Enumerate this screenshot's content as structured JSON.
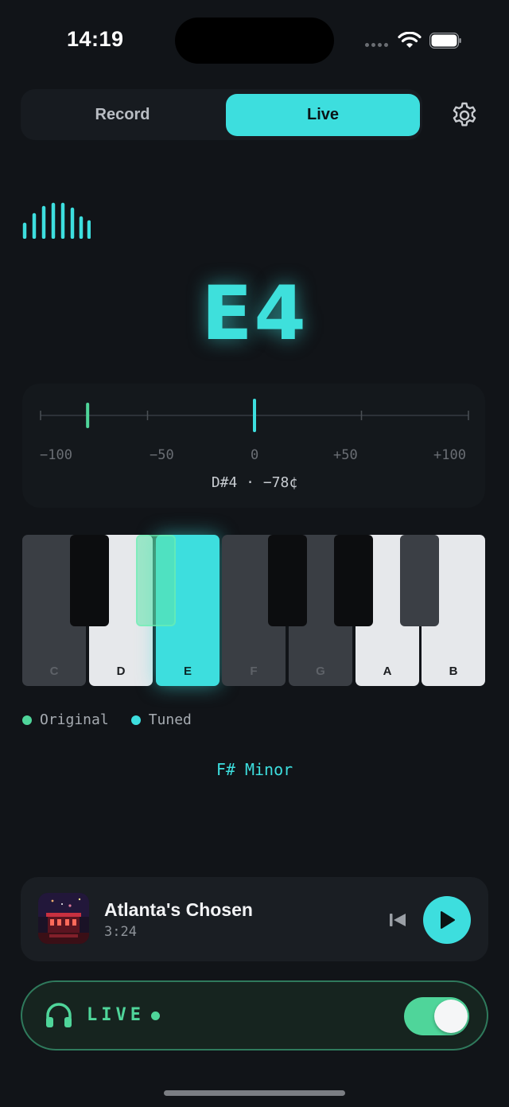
{
  "status_bar": {
    "time": "14:19"
  },
  "mode_tabs": {
    "record": "Record",
    "live": "Live",
    "active": "Live"
  },
  "icons": {
    "settings": "gear-icon",
    "level": "audio-level-icon",
    "prev": "skip-back-icon",
    "play": "play-icon",
    "headphones": "headphones-icon"
  },
  "tuner": {
    "note": "E4",
    "scale_labels": [
      "−100",
      "−50",
      "0",
      "+50",
      "+100"
    ],
    "detected_cents": -78,
    "readout": "D#4 · −78¢"
  },
  "piano": {
    "white_keys": [
      "C",
      "D",
      "E",
      "F",
      "G",
      "A",
      "B"
    ],
    "tuned_key": "E",
    "original_key": "D#"
  },
  "legend": {
    "original": "Original",
    "tuned": "Tuned"
  },
  "key_signature": "F# Minor",
  "player": {
    "title": "Atlanta's Chosen",
    "duration": "3:24"
  },
  "live_monitor": {
    "label": "LIVE",
    "enabled": true
  },
  "colors": {
    "accent": "#3ddede",
    "original": "#4fd59a",
    "background": "#111418"
  }
}
